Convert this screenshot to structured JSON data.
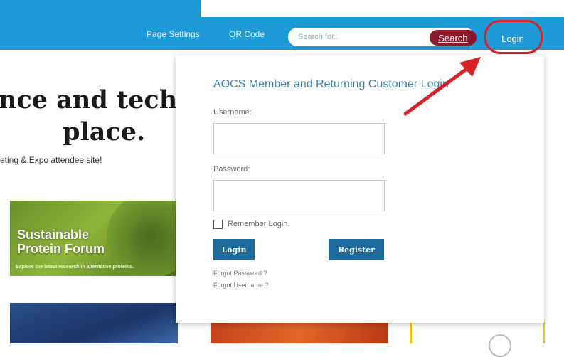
{
  "topbar": {
    "page_settings": "Page Settings",
    "qr_code": "QR Code",
    "search_placeholder": "Search for...",
    "search_button": "Search",
    "login_button": "Login"
  },
  "background": {
    "headline_line1": "nce and techı",
    "headline_line2": "place.",
    "attendee_text": "eting & Expo attendee site!",
    "promo_title_line1": "Sustainable",
    "promo_title_line2": "Protein Forum",
    "promo_subtitle": "Explore the latest research in alternative proteins."
  },
  "login_panel": {
    "title": "AOCS Member and Returning Customer Login",
    "username_label": "Username:",
    "password_label": "Password:",
    "remember_label": "Remember Login.",
    "login_button": "Login",
    "register_button": "Register",
    "forgot_password": "Forgot Password ?",
    "forgot_username": "Forgot Username ?"
  },
  "colors": {
    "brand_blue": "#1e9ad6",
    "search_button": "#8b1a2c",
    "annotation_red": "#d92027",
    "panel_button": "#1d6a9c"
  }
}
